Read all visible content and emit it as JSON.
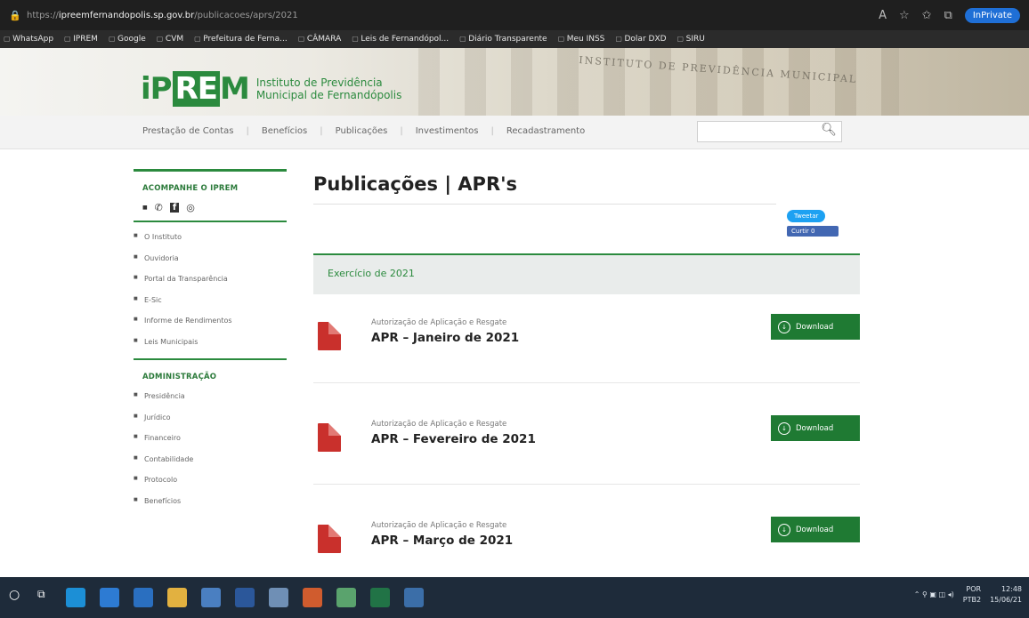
{
  "browser": {
    "url_prefix": "https://",
    "url_domain": "ipreemfernandopolis.sp.gov.br",
    "url_path": "/publicacoes/aprs/2021",
    "inprivate": "InPrivate"
  },
  "bookmarks": [
    "WhatsApp",
    "IPREM",
    "Google",
    "CVM",
    "Prefeitura de Ferna...",
    "CÂMARA",
    "Leis de Fernandópol...",
    "Diário Transparente",
    "Meu INSS",
    "Dolar DXD",
    "SIRU"
  ],
  "header": {
    "logo": "iPREM",
    "institute_line1": "Instituto de Previdência",
    "institute_line2": "Municipal de Fernandópolis",
    "engraving": "INSTITUTO DE PREVIDÊNCIA MUNICIPAL"
  },
  "nav": {
    "items": [
      "Prestação de Contas",
      "Benefícios",
      "Publicações",
      "Investimentos",
      "Recadastramento"
    ],
    "search_placeholder": ""
  },
  "sidebar": {
    "follow_title": "ACOMPANHE O IPREM",
    "social": [
      "whatsapp",
      "facebook",
      "instagram"
    ],
    "links": [
      "O Instituto",
      "Ouvidoria",
      "Portal da Transparência",
      "E-Sic",
      "Informe de Rendimentos",
      "Leis Municipais"
    ],
    "admin_title": "ADMINISTRAÇÃO",
    "admin_links": [
      "Presidência",
      "Jurídico",
      "Financeiro",
      "Contabilidade",
      "Protocolo",
      "Benefícios"
    ]
  },
  "main": {
    "title": "Publicações | APR's",
    "tweet": "Tweetar",
    "like": "Curtir 0",
    "year": "Exercício de 2021",
    "entries": [
      {
        "subtitle": "Autorização de Aplicação e Resgate",
        "name": "APR – Janeiro de 2021",
        "button": "Download"
      },
      {
        "subtitle": "Autorização de Aplicação e Resgate",
        "name": "APR – Fevereiro de 2021",
        "button": "Download"
      },
      {
        "subtitle": "Autorização de Aplicação e Resgate",
        "name": "APR – Março de 2021",
        "button": "Download"
      }
    ]
  },
  "taskbar": {
    "lang1": "POR",
    "lang2": "PTB2",
    "time": "12:48",
    "date": "15/06/21"
  }
}
